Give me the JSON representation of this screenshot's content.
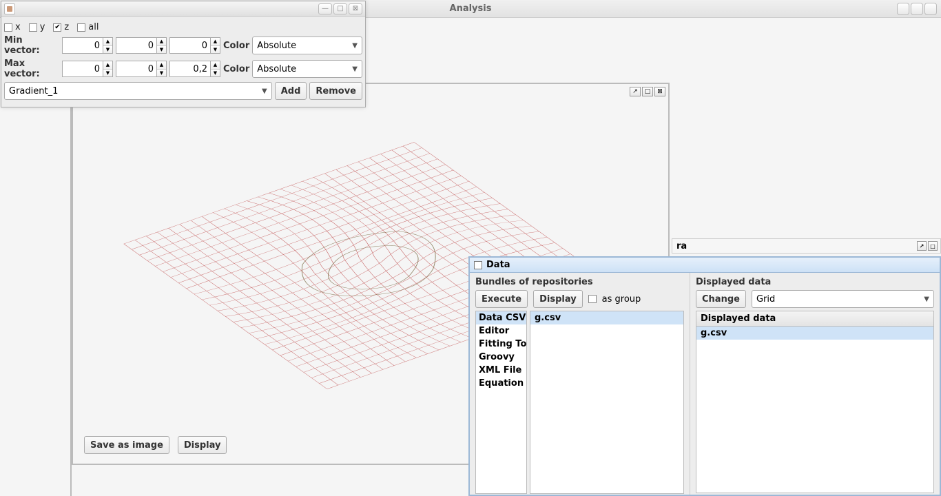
{
  "main_window": {
    "title": "Analysis"
  },
  "float_window": {
    "checks": {
      "x": {
        "label": "x",
        "checked": false
      },
      "y": {
        "label": "y",
        "checked": false
      },
      "z": {
        "label": "z",
        "checked": true
      },
      "all": {
        "label": "all",
        "checked": false
      }
    },
    "min_vector": {
      "label": "Min vector:",
      "x": "0",
      "y": "0",
      "z": "0",
      "color_label": "Color",
      "color_mode": "Absolute"
    },
    "max_vector": {
      "label": "Max vector:",
      "x": "0",
      "y": "0",
      "z": "0,2",
      "color_label": "Color",
      "color_mode": "Absolute"
    },
    "gradient": {
      "name": "Gradient_1",
      "add": "Add",
      "remove": "Remove"
    }
  },
  "plot": {
    "save_btn": "Save as image",
    "display_btn": "Display"
  },
  "ra_tab": {
    "label": "ra"
  },
  "data_window": {
    "title": "Data",
    "bundles": {
      "title": "Bundles of repositories",
      "execute": "Execute",
      "display": "Display",
      "as_group": "as group",
      "list": [
        "Data CSV",
        "Editor",
        "Fitting To",
        "Groovy",
        "XML File",
        "Equation"
      ],
      "files": [
        "g.csv"
      ]
    },
    "displayed": {
      "title": "Displayed data",
      "change": "Change",
      "mode": "Grid",
      "header": "Displayed data",
      "items": [
        "g.csv"
      ]
    }
  }
}
